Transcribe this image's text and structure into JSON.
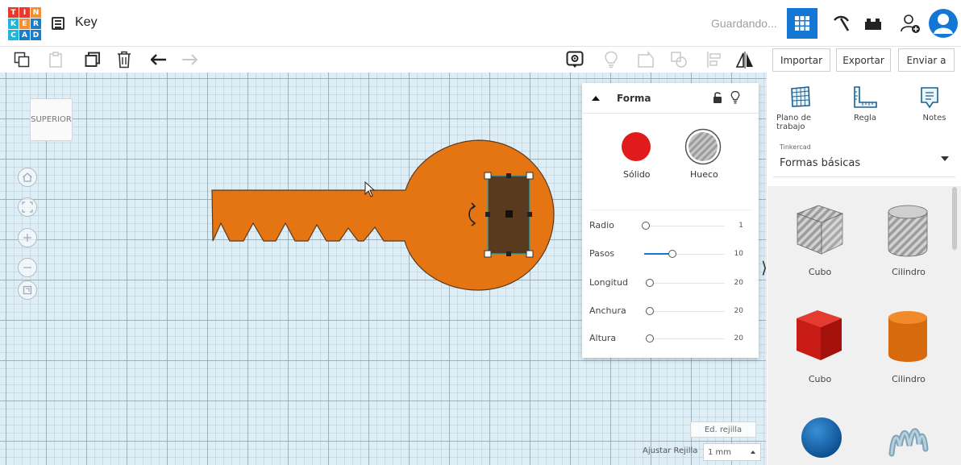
{
  "header": {
    "logo_letters": [
      "T",
      "I",
      "N",
      "K",
      "E",
      "R",
      "C",
      "A",
      "D"
    ],
    "design_title": "Key",
    "save_status": "Guardando...",
    "accent_color": "#1477d4"
  },
  "toolbar": {
    "import_label": "Importar",
    "export_label": "Exportar",
    "send_label": "Enviar a"
  },
  "workplane": {
    "view_cube_label": "SUPERIOR",
    "grid_edit_label": "Ed. rejilla",
    "snap_label": "Ajustar Rejilla",
    "snap_value": "1 mm",
    "key_color": "#e57512",
    "hole_color": "#5a3a1e"
  },
  "inspector": {
    "title": "Forma",
    "solid_label": "Sólido",
    "hole_label": "Hueco",
    "solid_color": "#e11b1b",
    "properties": [
      {
        "label": "Radio",
        "value": "1",
        "fill": 0.0
      },
      {
        "label": "Pasos",
        "value": "10",
        "fill": 0.35
      },
      {
        "label": "Longitud",
        "value": "20",
        "fill": 0.0
      },
      {
        "label": "Anchura",
        "value": "20",
        "fill": 0.0
      },
      {
        "label": "Altura",
        "value": "20",
        "fill": 0.0
      }
    ]
  },
  "right_panel": {
    "tools": [
      {
        "label": "Plano de trabajo",
        "icon": "workplane-icon"
      },
      {
        "label": "Regla",
        "icon": "ruler-icon"
      },
      {
        "label": "Notes",
        "icon": "notes-icon"
      }
    ],
    "library_caption": "Tinkercad",
    "library_value": "Formas básicas",
    "shapes": [
      {
        "name": "Cubo",
        "icon": "box-hole-icon"
      },
      {
        "name": "Cilindro",
        "icon": "cylinder-hole-icon"
      },
      {
        "name": "Cubo",
        "icon": "box-icon"
      },
      {
        "name": "Cilindro",
        "icon": "cylinder-icon"
      },
      {
        "name": "Esfera",
        "icon": "sphere-icon"
      },
      {
        "name": "Garabato",
        "icon": "scribble-icon"
      }
    ]
  }
}
